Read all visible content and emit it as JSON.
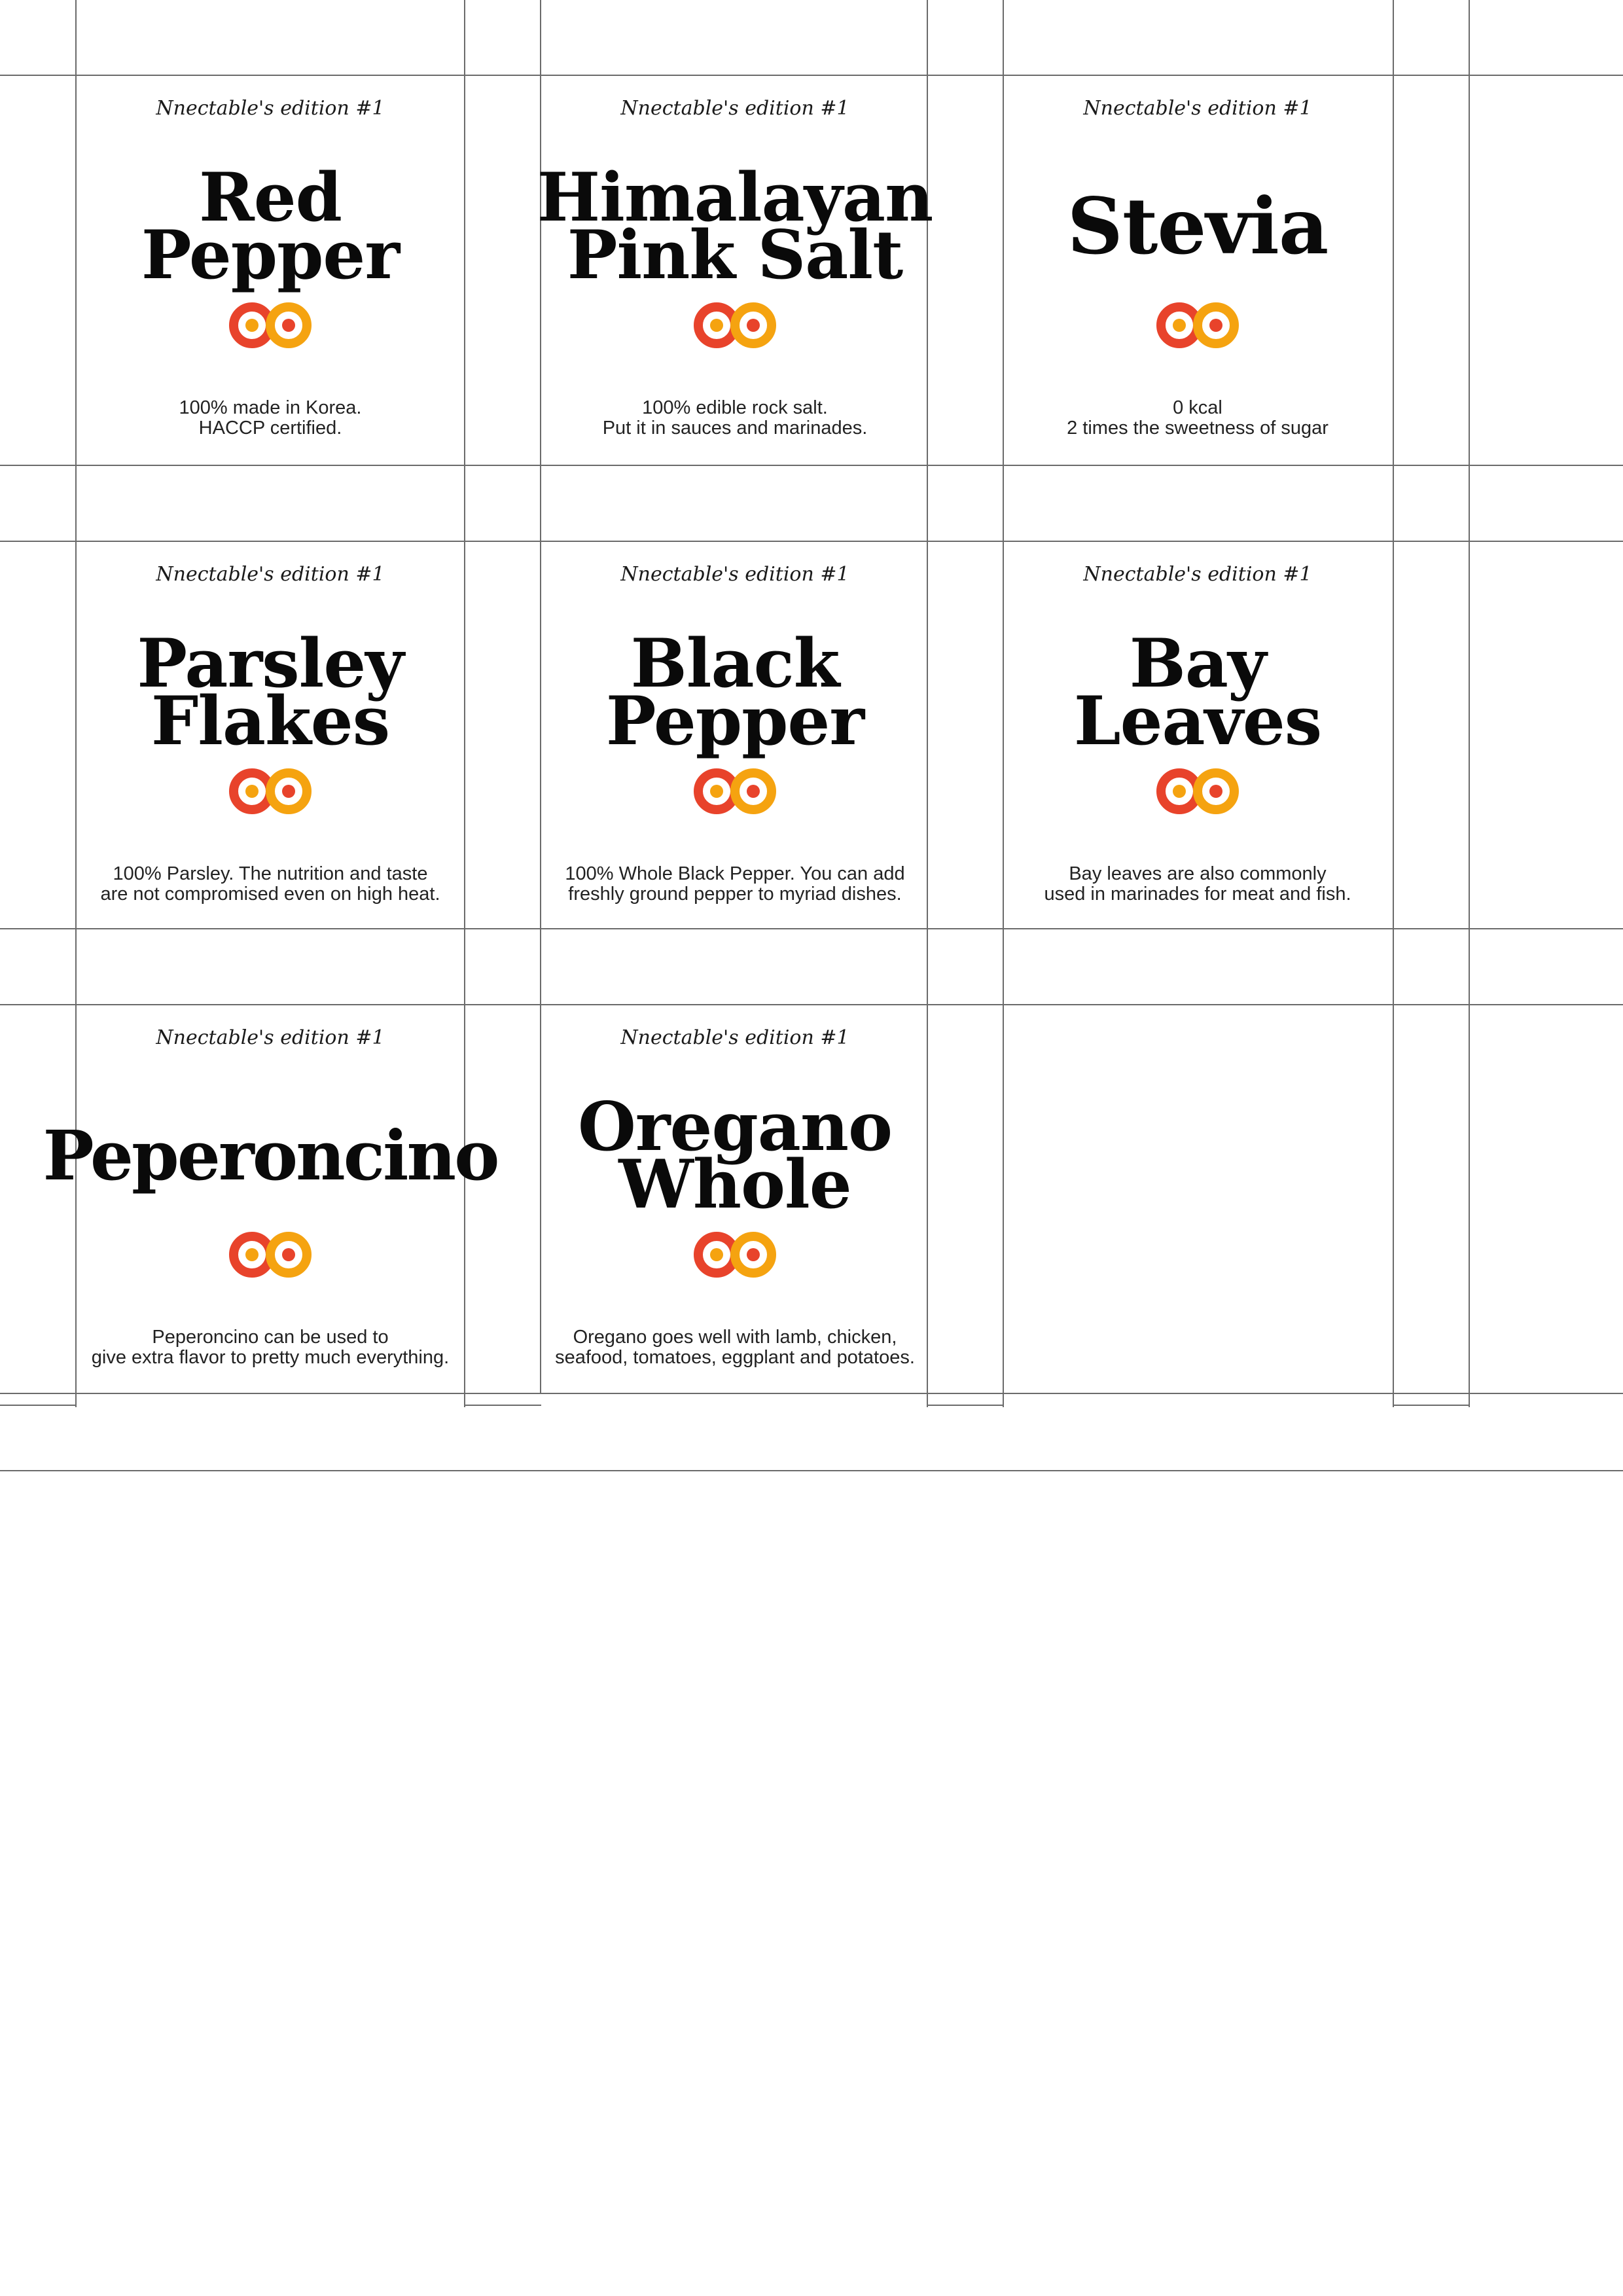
{
  "theme": {
    "logo_red": "#e8432b",
    "logo_orange": "#f5a310",
    "line_color": "#6b6b6b"
  },
  "labels": [
    {
      "edition": "Nnectable's edition #1",
      "title": [
        "Red",
        "Pepper"
      ],
      "desc": [
        "100% made in Korea.",
        "HACCP certified."
      ]
    },
    {
      "edition": "Nnectable's edition #1",
      "title": [
        "Himalayan",
        "Pink Salt"
      ],
      "desc": [
        "100% edible rock salt.",
        "Put it in sauces and marinades."
      ]
    },
    {
      "edition": "Nnectable's edition #1",
      "title": [
        "Stevia"
      ],
      "desc": [
        "0 kcal",
        "2 times the sweetness of sugar"
      ]
    },
    {
      "edition": "Nnectable's edition #1",
      "title": [
        "Parsley",
        "Flakes"
      ],
      "desc": [
        "100% Parsley. The nutrition and taste",
        "are not compromised even on high heat."
      ]
    },
    {
      "edition": "Nnectable's edition #1",
      "title": [
        "Black",
        "Pepper"
      ],
      "desc": [
        "100% Whole Black Pepper. You can add",
        "freshly ground pepper to myriad dishes."
      ]
    },
    {
      "edition": "Nnectable's edition #1",
      "title": [
        "Bay",
        "Leaves"
      ],
      "desc": [
        "Bay leaves are also commonly",
        "used in marinades for meat and fish."
      ]
    },
    {
      "edition": "Nnectable's edition #1",
      "title": [
        "Peperoncino"
      ],
      "desc": [
        "Peperoncino can be used to",
        "give extra flavor to pretty much everything."
      ]
    },
    {
      "edition": "Nnectable's edition #1",
      "title": [
        "Oregano",
        "Whole"
      ],
      "desc": [
        "Oregano goes well with lamb, chicken,",
        "seafood, tomatoes, eggplant and potatoes."
      ]
    }
  ]
}
